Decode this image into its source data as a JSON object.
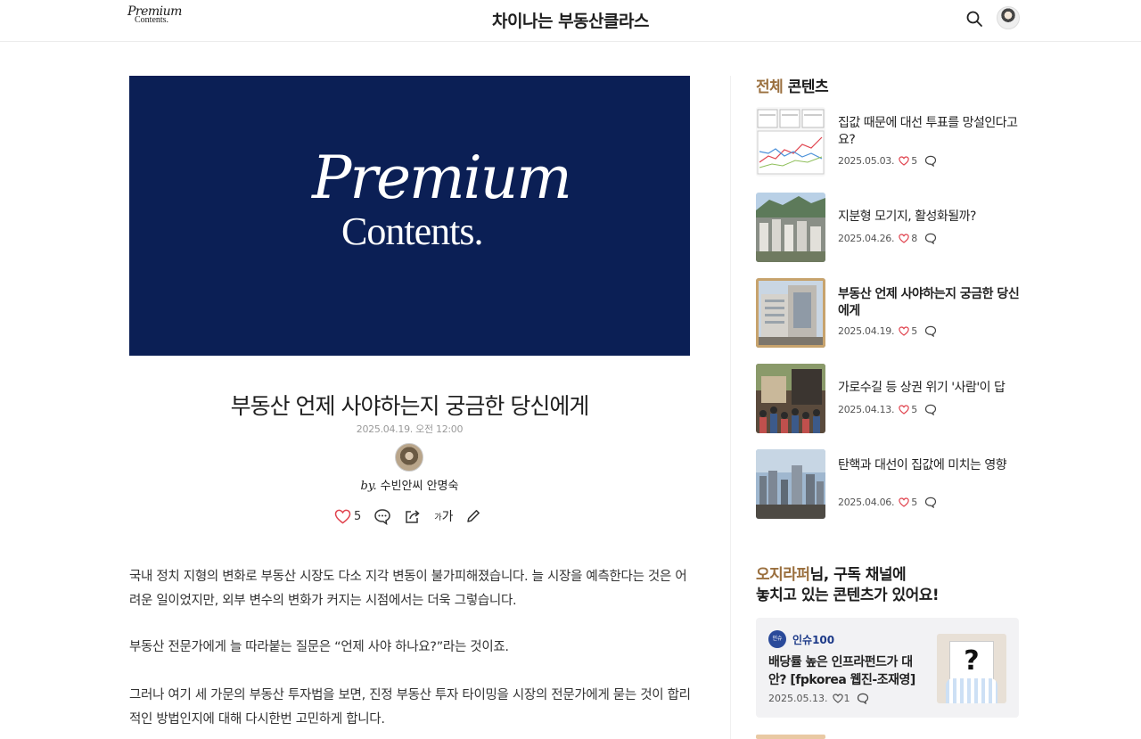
{
  "header": {
    "logo_line1": "Premium",
    "logo_line2": "Contents.",
    "site_title": "차이나는 부동산클라스",
    "search_icon": "search-icon",
    "avatar": "user-avatar"
  },
  "banner": {
    "line1": "Premium",
    "line2": "Contents.",
    "background_color": "#0b1f55"
  },
  "article": {
    "title": "부동산 언제 사야하는지 궁금한 당신에게",
    "date": "2025.04.19. 오전 12:00",
    "by_prefix": "by.",
    "author": "수빈안씨 안명숙",
    "likes": "5",
    "font_size_label_small": "가",
    "font_size_label": "가",
    "paragraphs": [
      "국내 정치 지형의 변화로 부동산 시장도 다소 지각 변동이 불가피해졌습니다. 늘 시장을 예측한다는 것은 어려운 일이었지만, 외부 변수의 변화가 커지는 시점에서는 더욱 그렇습니다.",
      "부동산 전문가에게 늘 따라붙는 질문은 “언제 사야 하나요?”라는 것이죠.",
      "그러나 여기 세 가문의 부동산 투자법을 보면, 진정 부동산 투자 타이밍을 시장의 전문가에게 묻는 것이 합리적인 방법인지에 대해 다시한번 고민하게 합니다."
    ]
  },
  "sidebar": {
    "title_accent": "전체",
    "title_rest": " 콘텐츠",
    "items": [
      {
        "title": "집값 때문에 대선 투표를 망설인다고요?",
        "date": "2025.05.03.",
        "likes": "5",
        "active": false
      },
      {
        "title": "지분형 모기지, 활성화될까?",
        "date": "2025.04.26.",
        "likes": "8",
        "active": false
      },
      {
        "title": "부동산 언제 사야하는지 궁금한 당신에게",
        "date": "2025.04.19.",
        "likes": "5",
        "active": true
      },
      {
        "title": "가로수길 등 상권 위기 '사람'이 답",
        "date": "2025.04.13.",
        "likes": "5",
        "active": false
      },
      {
        "title": "탄핵과 대선이 집값에 미치는 영향",
        "date": "2025.04.06.",
        "likes": "5",
        "active": false
      }
    ]
  },
  "promo": {
    "title_accent": "오지라퍼",
    "title_rest1": "님, 구독 채널에",
    "title_rest2": "놓치고 있는 콘텐츠가 있어요!",
    "card": {
      "badge": "인슈100",
      "channel": "인슈100",
      "title": "배당률 높은 인프라펀드가 대안? [fpkorea 웹진-조재영]",
      "date": "2025.05.13.",
      "likes": "1",
      "thumb_mark": "?"
    }
  },
  "colors": {
    "accent": "#9a6f3e",
    "like": "#e0434e",
    "channel": "#1d3a88"
  }
}
